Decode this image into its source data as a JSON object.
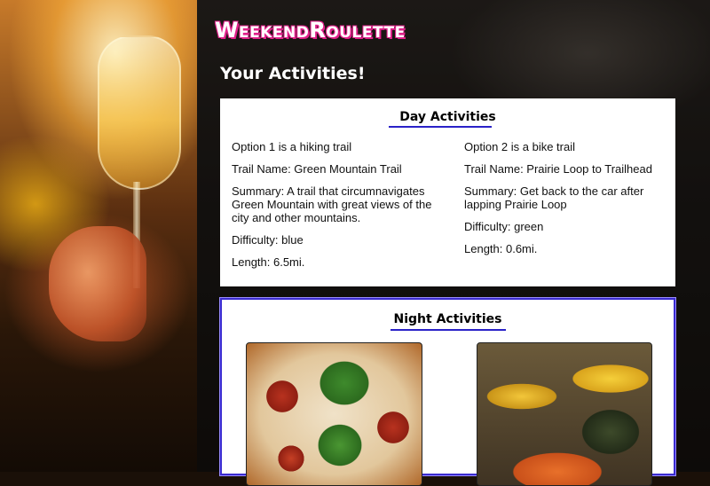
{
  "header": {
    "logo": "WeekendRoulette",
    "section_title": "Your Activities!"
  },
  "day": {
    "heading": "Day Activities",
    "options": [
      {
        "intro": "Option 1 is a hiking trail",
        "trail_name": "Trail Name: Green Mountain Trail",
        "summary": "Summary: A trail that circumnavigates Green Mountain with great views of the city and other mountains.",
        "difficulty": "Difficulty: blue",
        "length": "Length: 6.5mi."
      },
      {
        "intro": "Option 2 is a bike trail",
        "trail_name": "Trail Name: Prairie Loop to Trailhead",
        "summary": "Summary: Get back to the car after lapping Prairie Loop",
        "difficulty": "Difficulty: green",
        "length": "Length: 0.6mi."
      }
    ]
  },
  "night": {
    "heading": "Night Activities",
    "images": [
      "pizza-photo",
      "grilled-vegetables-photo"
    ]
  },
  "colors": {
    "logo_outline": "#e0208a",
    "underline": "#2a22c8",
    "night_border": "#3a2bd0"
  }
}
